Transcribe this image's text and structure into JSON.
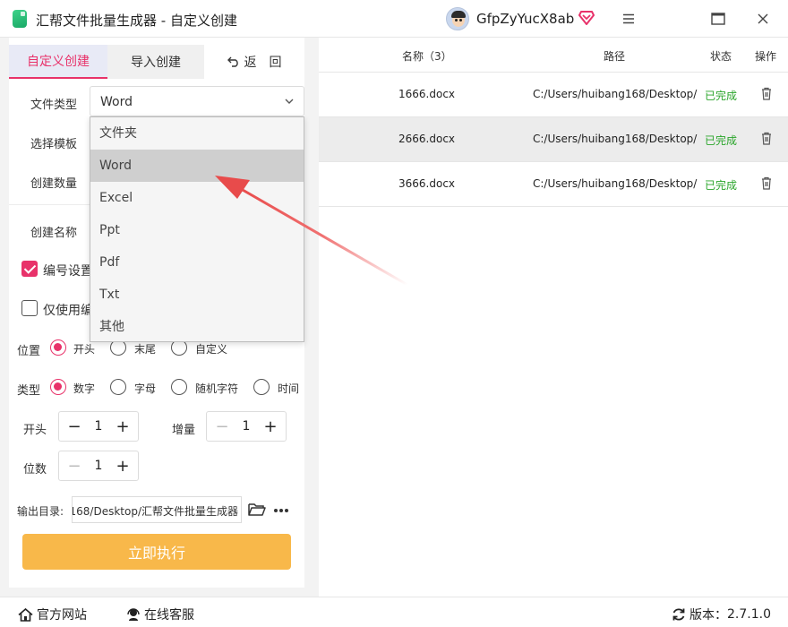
{
  "window": {
    "title": "汇帮文件批量生成器 - 自定义创建",
    "user_name": "GfpZyYucX8ab",
    "controls": [
      "≡",
      "□",
      "×"
    ]
  },
  "tabs": {
    "custom": "自定义创建",
    "import": "导入创建",
    "back": "返　回"
  },
  "form": {
    "file_type_label": "文件类型",
    "file_type_value": "Word",
    "template_label": "选择模板",
    "count_label": "创建数量",
    "name_label": "创建名称",
    "numbering_label": "编号设置",
    "numbering_checked": true,
    "only_number_label": "仅使用编",
    "only_number_checked": false,
    "position_label": "位置",
    "position_options": [
      "开头",
      "末尾",
      "自定义"
    ],
    "position_selected": "开头",
    "type_label": "类型",
    "type_options": [
      "数字",
      "字母",
      "随机字符",
      "时间"
    ],
    "type_selected": "数字",
    "start_label": "开头",
    "start_value": "1",
    "increment_label": "增量",
    "increment_value": "1",
    "digits_label": "位数",
    "digits_value": "1",
    "output_label": "输出目录:",
    "output_value": "168/Desktop/汇帮文件批量生成器",
    "execute_label": "立即执行"
  },
  "dropdown": {
    "options": [
      "文件夹",
      "Word",
      "Excel",
      "Ppt",
      "Pdf",
      "Txt",
      "其他"
    ],
    "highlighted": "Word"
  },
  "table": {
    "headers": {
      "name": "名称（3）",
      "path": "路径",
      "status": "状态",
      "action": "操作"
    },
    "rows": [
      {
        "name": "1666.docx",
        "path": "C:/Users/huibang168/Desktop/",
        "status": "已完成"
      },
      {
        "name": "2666.docx",
        "path": "C:/Users/huibang168/Desktop/",
        "status": "已完成"
      },
      {
        "name": "3666.docx",
        "path": "C:/Users/huibang168/Desktop/",
        "status": "已完成"
      }
    ]
  },
  "footer": {
    "website": "官方网站",
    "support": "在线客服",
    "version_label": "版本：",
    "version": "2.7.1.0"
  },
  "colors": {
    "accent": "#e8326a",
    "execute": "#f8b84a",
    "status_done": "#2aa52a",
    "arrow": "#e84b4b"
  }
}
